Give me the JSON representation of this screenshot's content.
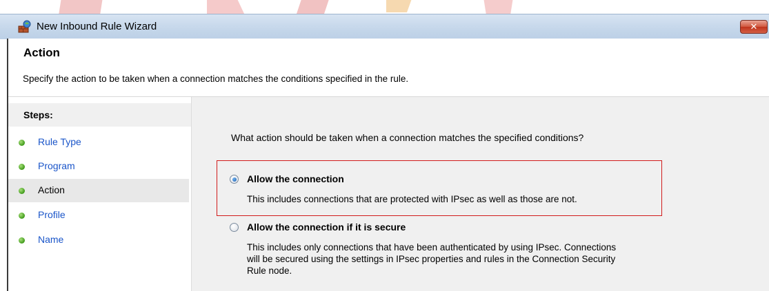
{
  "window": {
    "title": "New Inbound Rule Wizard",
    "close_label": "✕"
  },
  "header": {
    "title": "Action",
    "description": "Specify the action to be taken when a connection matches the conditions specified in the rule."
  },
  "steps": {
    "title": "Steps:",
    "items": [
      {
        "label": "Rule Type",
        "current": false
      },
      {
        "label": "Program",
        "current": false
      },
      {
        "label": "Action",
        "current": true
      },
      {
        "label": "Profile",
        "current": false
      },
      {
        "label": "Name",
        "current": false
      }
    ]
  },
  "main": {
    "question": "What action should be taken when a connection matches the specified conditions?",
    "options": [
      {
        "title": "Allow the connection",
        "description": "This includes connections that are protected with IPsec as well as those are not.",
        "selected": true
      },
      {
        "title": "Allow the connection if it is secure",
        "description_lines": [
          "This includes only connections that have been authenticated by using IPsec.  Connections",
          "will be secured using the settings in IPsec properties and rules in the Connection Security",
          "Rule node."
        ],
        "selected": false
      }
    ]
  },
  "colors": {
    "link": "#1a55c9",
    "highlight": "#d11a1a",
    "step_dot": "#3f9a1a"
  }
}
